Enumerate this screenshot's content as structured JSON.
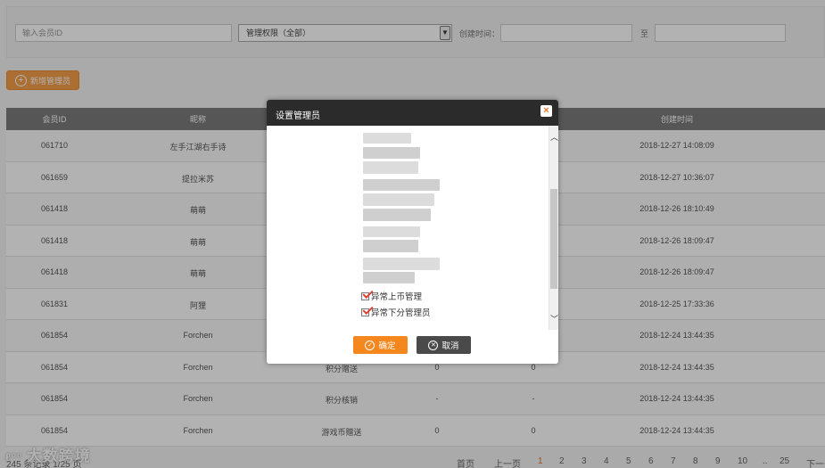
{
  "filters": {
    "member_id_placeholder": "输入会员ID",
    "permission_select": "管理权限（全部）",
    "created_label": "创建时间：",
    "to_label": "至"
  },
  "add_button": "新增管理员",
  "table": {
    "headers": [
      "会员ID",
      "昵称",
      "",
      "",
      "创建时间"
    ],
    "rows": [
      {
        "id": "061710",
        "nick": "左手江湖右手诗",
        "perm": "",
        "v": "",
        "time": "2018-12-27 14:08:09"
      },
      {
        "id": "061659",
        "nick": "提拉米苏",
        "perm": "",
        "v": "",
        "time": "2018-12-27 10:36:07"
      },
      {
        "id": "061418",
        "nick": "萌萌",
        "perm": "",
        "v": "",
        "time": "2018-12-26 18:10:49"
      },
      {
        "id": "061418",
        "nick": "萌萌",
        "perm": "",
        "v": "",
        "time": "2018-12-26 18:09:47"
      },
      {
        "id": "061418",
        "nick": "萌萌",
        "perm": "",
        "v": "",
        "time": "2018-12-26 18:09:47"
      },
      {
        "id": "061831",
        "nick": "阿狸",
        "perm": "",
        "v": "",
        "time": "2018-12-25 17:33:36"
      },
      {
        "id": "061854",
        "nick": "Forchen",
        "perm": "",
        "v": "",
        "time": "2018-12-24 13:44:35"
      },
      {
        "id": "061854",
        "nick": "Forchen",
        "perm": "积分赠送",
        "v1": "0",
        "v2": "0",
        "time": "2018-12-24 13:44:35"
      },
      {
        "id": "061854",
        "nick": "Forchen",
        "perm": "积分核销",
        "v1": "-",
        "v2": "-",
        "time": "2018-12-24 13:44:35"
      },
      {
        "id": "061854",
        "nick": "Forchen",
        "perm": "游戏币赠送",
        "v1": "0",
        "v2": "0",
        "time": "2018-12-24 13:44:35"
      }
    ]
  },
  "footer": {
    "records": "245 条记录 1/25 页",
    "pager": [
      "首页",
      "上一页",
      "1",
      "2",
      "3",
      "4",
      "5",
      "6",
      "7",
      "8",
      "9",
      "10",
      "..",
      "25",
      "下一"
    ]
  },
  "watermark": "大数跨境",
  "modal": {
    "title": "设置管理员",
    "permissions": [
      "异常上币管理",
      "异常下分管理员"
    ],
    "ok": "确定",
    "cancel": "取消"
  },
  "colors": {
    "accent": "#f5871f",
    "header": "#7b7b7b",
    "modal_header": "#2b2b2b"
  }
}
